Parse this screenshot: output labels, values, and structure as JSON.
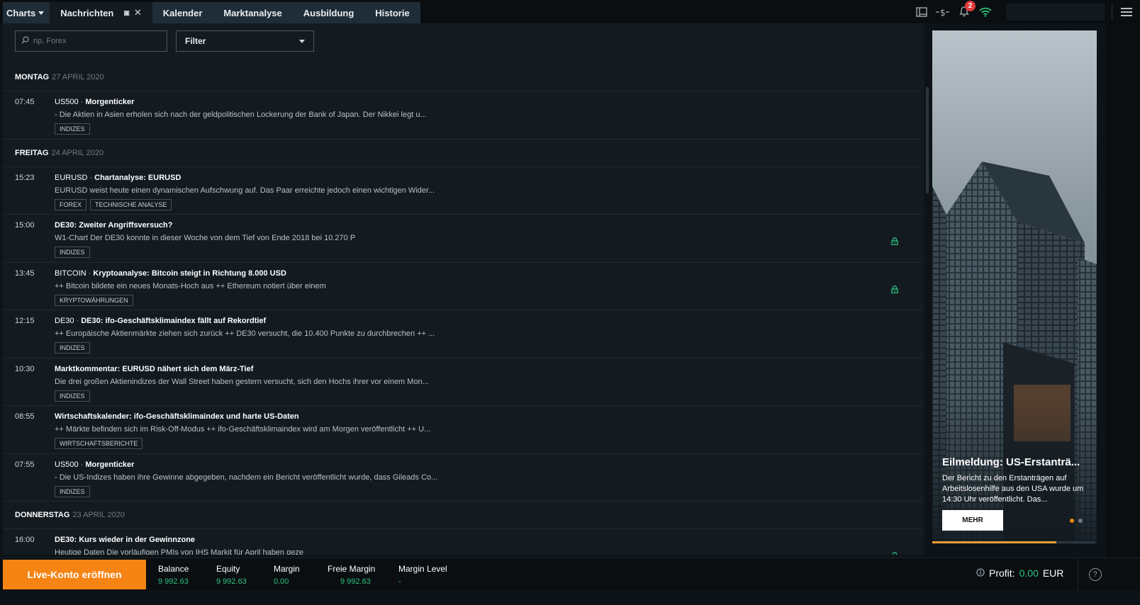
{
  "tabs": [
    {
      "label": "Charts"
    },
    {
      "label": "Nachrichten"
    },
    {
      "label": "Kalender"
    },
    {
      "label": "Marktanalyse"
    },
    {
      "label": "Ausbildung"
    },
    {
      "label": "Historie"
    }
  ],
  "header": {
    "notification_count": "2",
    "icons": [
      "layout-icon",
      "dollar-transfer-icon",
      "bell-icon",
      "wifi-icon",
      "hamburger-menu-icon"
    ]
  },
  "search": {
    "placeholder": "np. Forex"
  },
  "filter": {
    "label": "Filter"
  },
  "news": [
    {
      "day": "MONTAG",
      "date": "27 APRIL 2020",
      "items": [
        {
          "time": "07:45",
          "symbol": "US500",
          "sep": "·",
          "headline": "Morgenticker",
          "text": "- Die Aktien in Asien erholen sich nach der geldpolitischen Lockerung der Bank of Japan. Der Nikkei legt u...",
          "tags": [
            "INDIZES"
          ],
          "locked": false
        }
      ]
    },
    {
      "day": "FREITAG",
      "date": "24 APRIL 2020",
      "items": [
        {
          "time": "15:23",
          "symbol": "EURUSD",
          "sep": "·",
          "headline": "Chartanalyse: EURUSD",
          "text": "EURUSD weist heute einen dynamischen Aufschwung auf. Das Paar erreichte jedoch einen wichtigen Wider...",
          "tags": [
            "FOREX",
            "TECHNISCHE ANALYSE"
          ],
          "locked": false
        },
        {
          "time": "15:00",
          "symbol": "",
          "sep": "",
          "headline": "DE30: Zweiter Angriffsversuch?",
          "text": "W1-Chart Der DE30 konnte in dieser Woche von dem Tief von Ende 2018 bei 10.270 P",
          "tags": [
            "INDIZES"
          ],
          "locked": true
        },
        {
          "time": "13:45",
          "symbol": "BITCOIN",
          "sep": "·",
          "headline": "Kryptoanalyse: Bitcoin steigt in Richtung 8.000 USD",
          "text": "++ Bitcoin bildete ein neues Monats-Hoch aus ++ Ethereum notiert über einem",
          "tags": [
            "KRYPTOWÄHRUNGEN"
          ],
          "locked": true
        },
        {
          "time": "12:15",
          "symbol": "DE30",
          "sep": "·",
          "headline": "DE30: ifo-Geschäftsklimaindex fällt auf Rekordtief",
          "text": "++ Europäische Aktienmärkte ziehen sich zurück ++ DE30 versucht, die 10.400 Punkte zu durchbrechen ++ ...",
          "tags": [
            "INDIZES"
          ],
          "locked": false
        },
        {
          "time": "10:30",
          "symbol": "",
          "sep": "",
          "headline": "Marktkommentar: EURUSD nähert sich dem März-Tief",
          "text": "Die drei großen Aktienindizes der Wall Street haben gestern versucht, sich den Hochs ihrer vor einem Mon...",
          "tags": [
            "INDIZES"
          ],
          "locked": false
        },
        {
          "time": "08:55",
          "symbol": "",
          "sep": "",
          "headline": "Wirtschaftskalender: ifo-Geschäftsklimaindex und harte US-Daten",
          "text": "++ Märkte befinden sich im Risk-Off-Modus ++ ifo-Geschäftsklimaindex wird am Morgen veröffentlicht ++ U...",
          "tags": [
            "WIRTSCHAFTSBERICHTE"
          ],
          "locked": false
        },
        {
          "time": "07:55",
          "symbol": "US500",
          "sep": "·",
          "headline": "Morgenticker",
          "text": "- Die US-Indizes haben ihre Gewinne abgegeben, nachdem ein Bericht veröffentlicht wurde, dass Gileads Co...",
          "tags": [
            "INDIZES"
          ],
          "locked": false
        }
      ]
    },
    {
      "day": "DONNERSTAG",
      "date": "23 APRIL 2020",
      "items": [
        {
          "time": "16:00",
          "symbol": "",
          "sep": "",
          "headline": "DE30: Kurs wieder in der Gewinnzone",
          "text": "Heutige Daten Die vorläufigen PMIs von IHS Markit für April haben geze",
          "tags": [],
          "locked": true
        }
      ]
    }
  ],
  "promo": {
    "title": "Eilmeldung: US-Erstanträ...",
    "text": "Der Bericht zu den Erstanträgen auf Arbeitslosenhilfe aus den USA wurde um 14:30 Uhr veröffentlicht. Das...",
    "button": "MEHR",
    "active_slide": 1,
    "slide_count": 2,
    "progress": 0.76
  },
  "bottom": {
    "live_button": "Live-Konto eröffnen",
    "metrics": [
      {
        "label": "Balance",
        "value": "9 992.63"
      },
      {
        "label": "Equity",
        "value": "9 992.63"
      },
      {
        "label": "Margin",
        "value": "0.00"
      },
      {
        "label": "Freie Margin",
        "value": "9 992.63"
      },
      {
        "label": "Margin Level",
        "value": "-"
      }
    ],
    "profit_label": "Profit:",
    "profit_value": "0.00",
    "profit_currency": "EUR",
    "help": "?"
  },
  "colors": {
    "accent_orange": "#f58414",
    "positive_green": "#2ec27e",
    "badge_red": "#e03a3a",
    "background": "#131b21"
  }
}
